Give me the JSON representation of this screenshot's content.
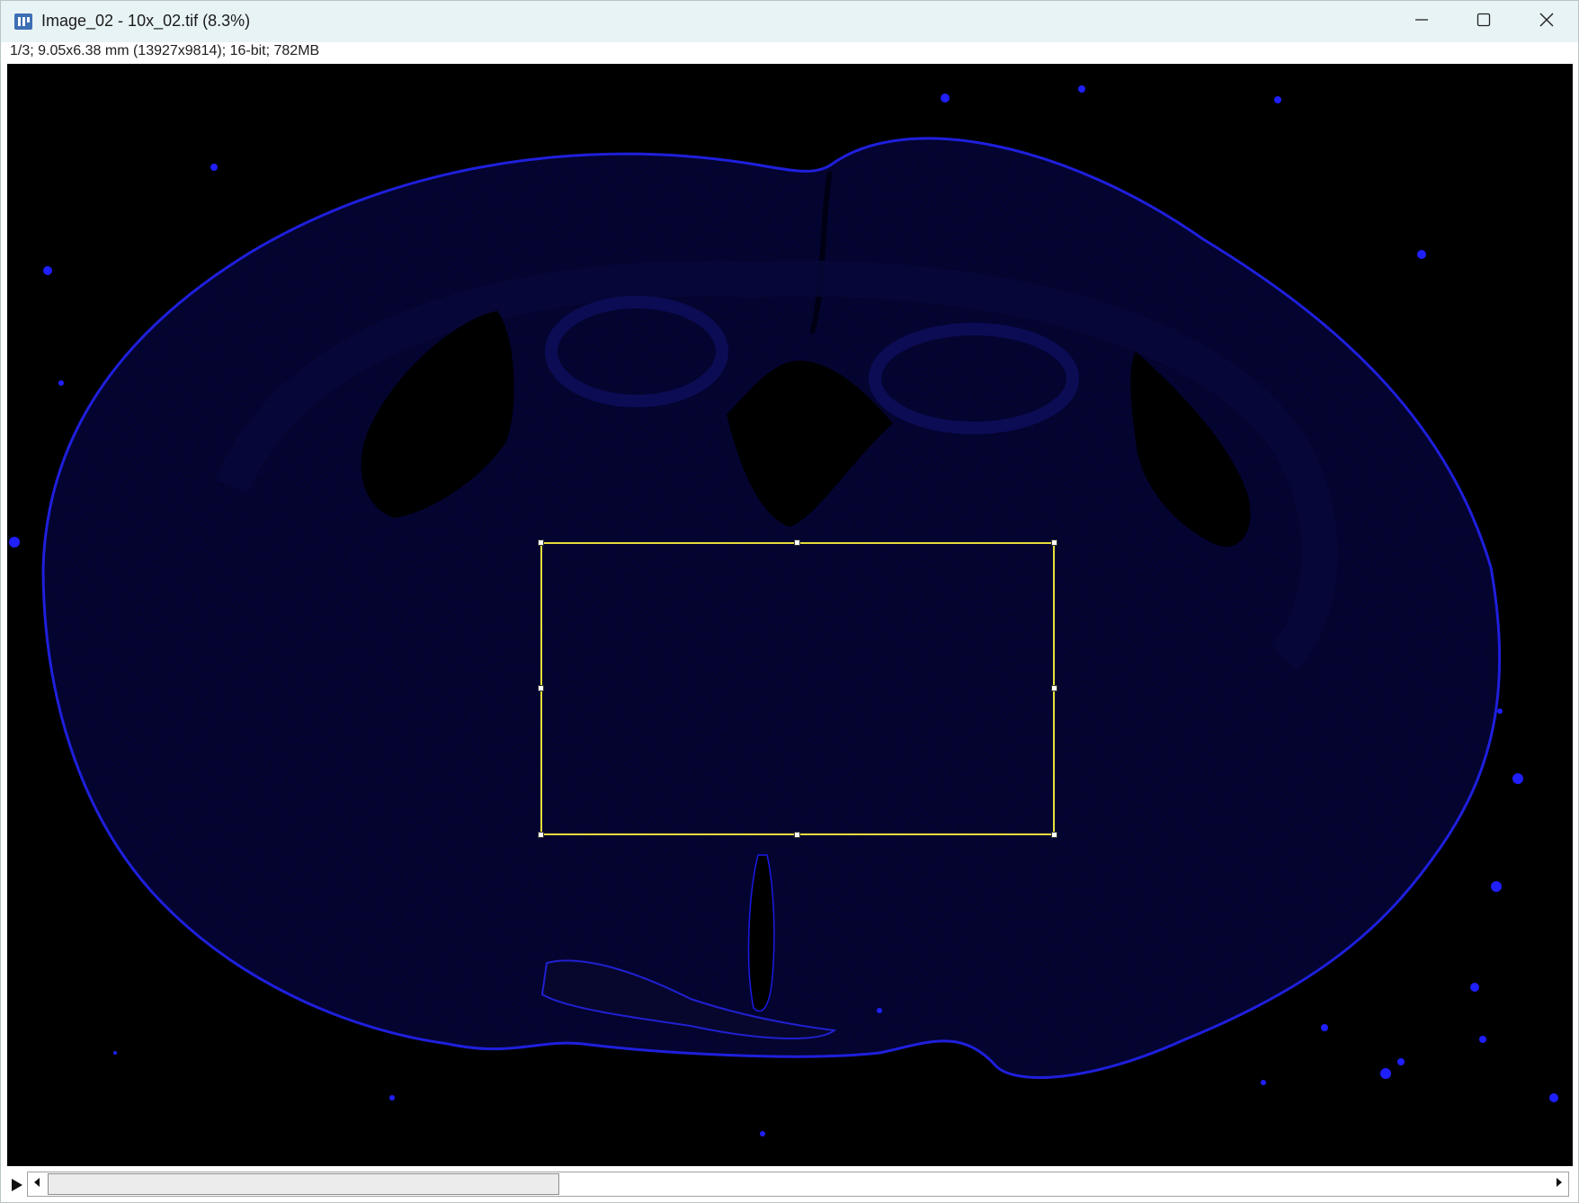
{
  "window": {
    "title": "Image_02 - 10x_02.tif (8.3%)",
    "info": "1/3; 9.05x6.38 mm (13927x9814); 16-bit; 782MB"
  },
  "icons": {
    "app": "imagej-icon",
    "minimize": "minimize-icon",
    "maximize": "maximize-icon",
    "close": "close-icon",
    "play": "play-icon",
    "scroll_left": "arrow-left-icon",
    "scroll_right": "arrow-right-icon"
  },
  "colors": {
    "titlebar": "#e8f3f5",
    "canvas": "#000000",
    "tissue_stain": "#1a1ae6",
    "roi": "#e6de3a"
  },
  "scrollbar": {
    "position_fraction": 0.0,
    "visible_fraction": 0.34
  },
  "roi": {
    "shape": "rectangle"
  }
}
